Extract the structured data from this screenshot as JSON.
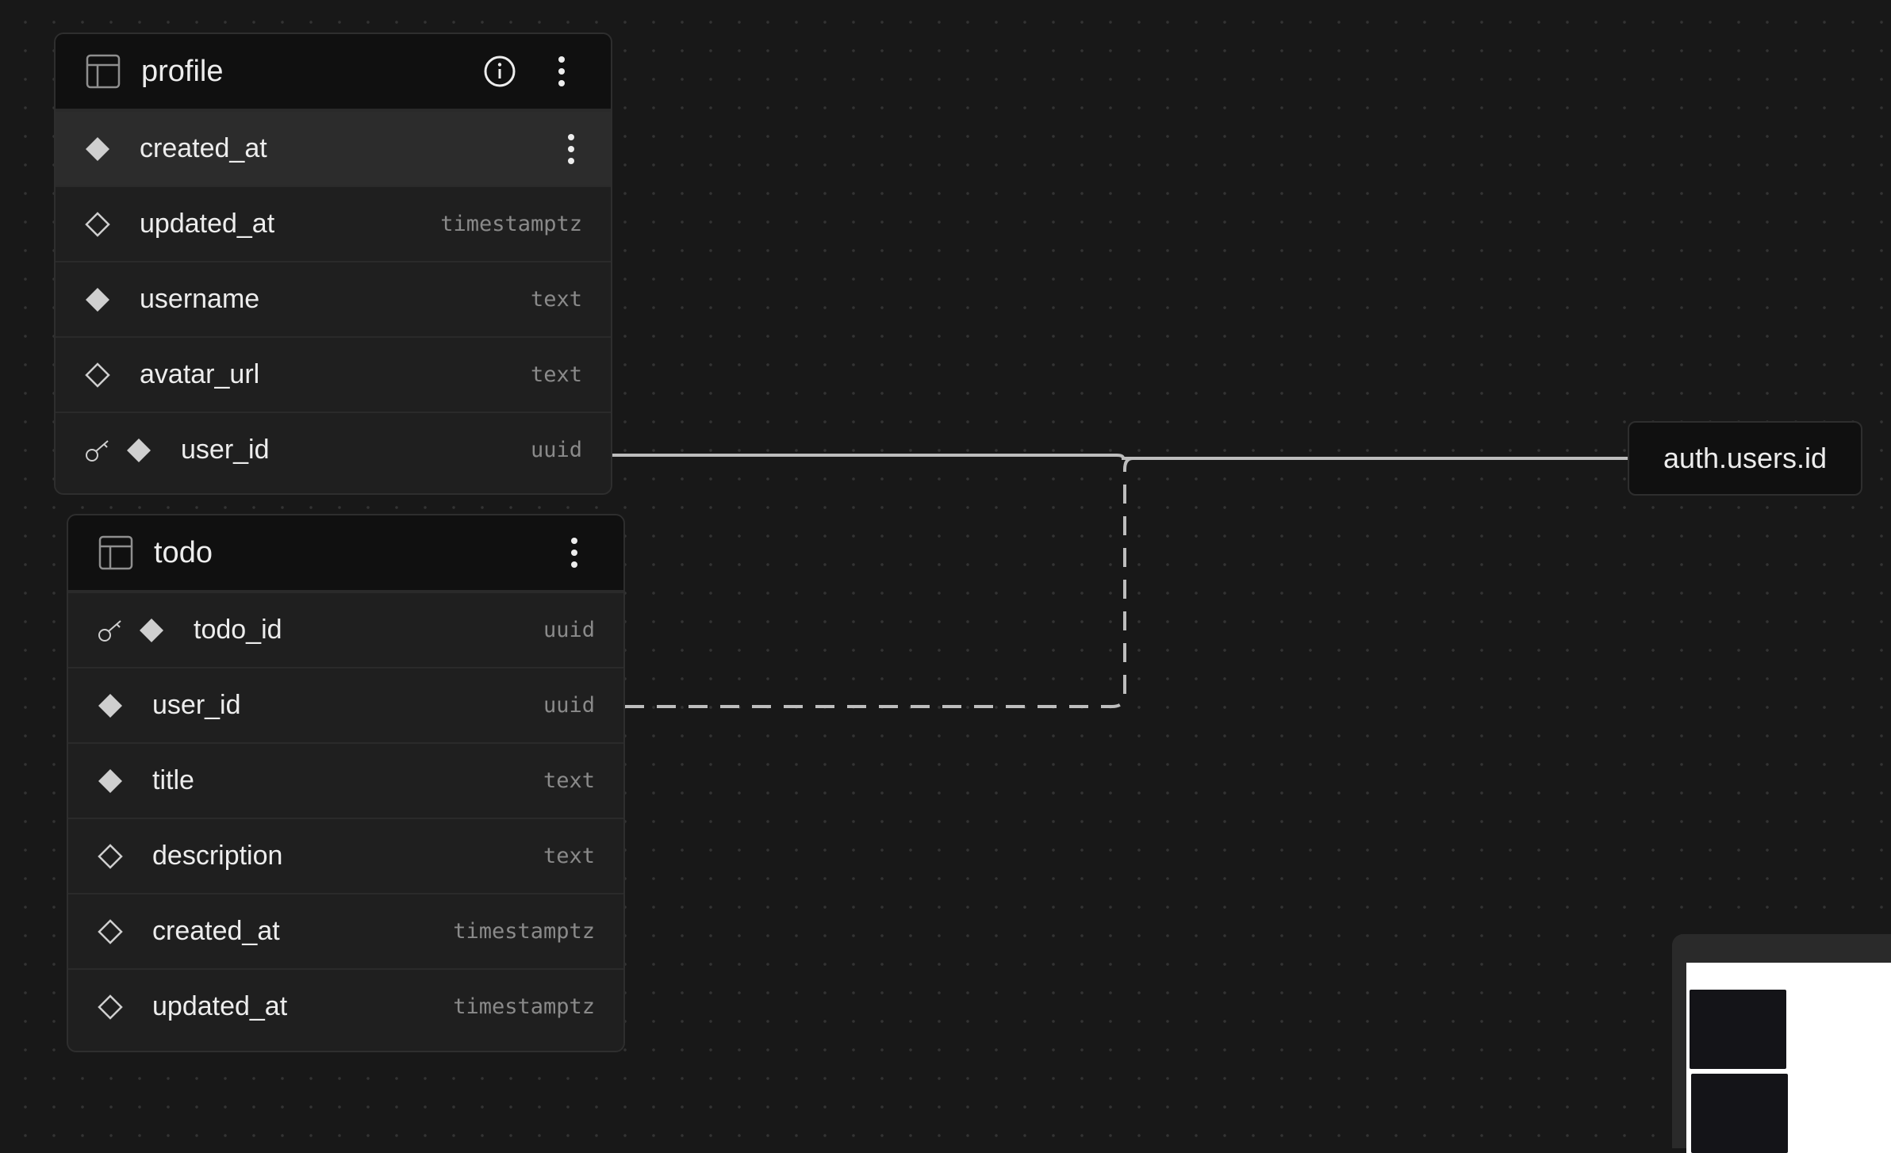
{
  "canvas": {
    "background": "#181818",
    "dot_color": "#333333"
  },
  "colors": {
    "card_bg": "#1f1f1f",
    "header_bg": "#101010",
    "selected_row_bg": "#2c2c2c",
    "text": "#ededed",
    "type_text": "#8a8a8a",
    "edge": "#bdbdbd"
  },
  "tables": {
    "profile": {
      "name": "profile",
      "icons": [
        "table-icon",
        "info-icon",
        "more-vertical-icon"
      ],
      "columns": [
        {
          "name": "created_at",
          "type": "",
          "required": true,
          "primary_key": false,
          "selected": true
        },
        {
          "name": "updated_at",
          "type": "timestamptz",
          "required": false,
          "primary_key": false
        },
        {
          "name": "username",
          "type": "text",
          "required": true,
          "primary_key": false
        },
        {
          "name": "avatar_url",
          "type": "text",
          "required": false,
          "primary_key": false
        },
        {
          "name": "user_id",
          "type": "uuid",
          "required": true,
          "primary_key": true
        }
      ]
    },
    "todo": {
      "name": "todo",
      "icons": [
        "table-icon",
        "more-vertical-icon"
      ],
      "columns": [
        {
          "name": "todo_id",
          "type": "uuid",
          "required": true,
          "primary_key": true
        },
        {
          "name": "user_id",
          "type": "uuid",
          "required": true,
          "primary_key": false
        },
        {
          "name": "title",
          "type": "text",
          "required": true,
          "primary_key": false
        },
        {
          "name": "description",
          "type": "text",
          "required": false,
          "primary_key": false
        },
        {
          "name": "created_at",
          "type": "timestamptz",
          "required": false,
          "primary_key": false
        },
        {
          "name": "updated_at",
          "type": "timestamptz",
          "required": false,
          "primary_key": false
        }
      ]
    }
  },
  "reference": {
    "label": "auth.users.id"
  },
  "relationships": [
    {
      "from": "profile.user_id",
      "to": "auth.users.id",
      "style": "solid"
    },
    {
      "from": "todo.user_id",
      "to": "auth.users.id",
      "style": "dashed"
    }
  ]
}
